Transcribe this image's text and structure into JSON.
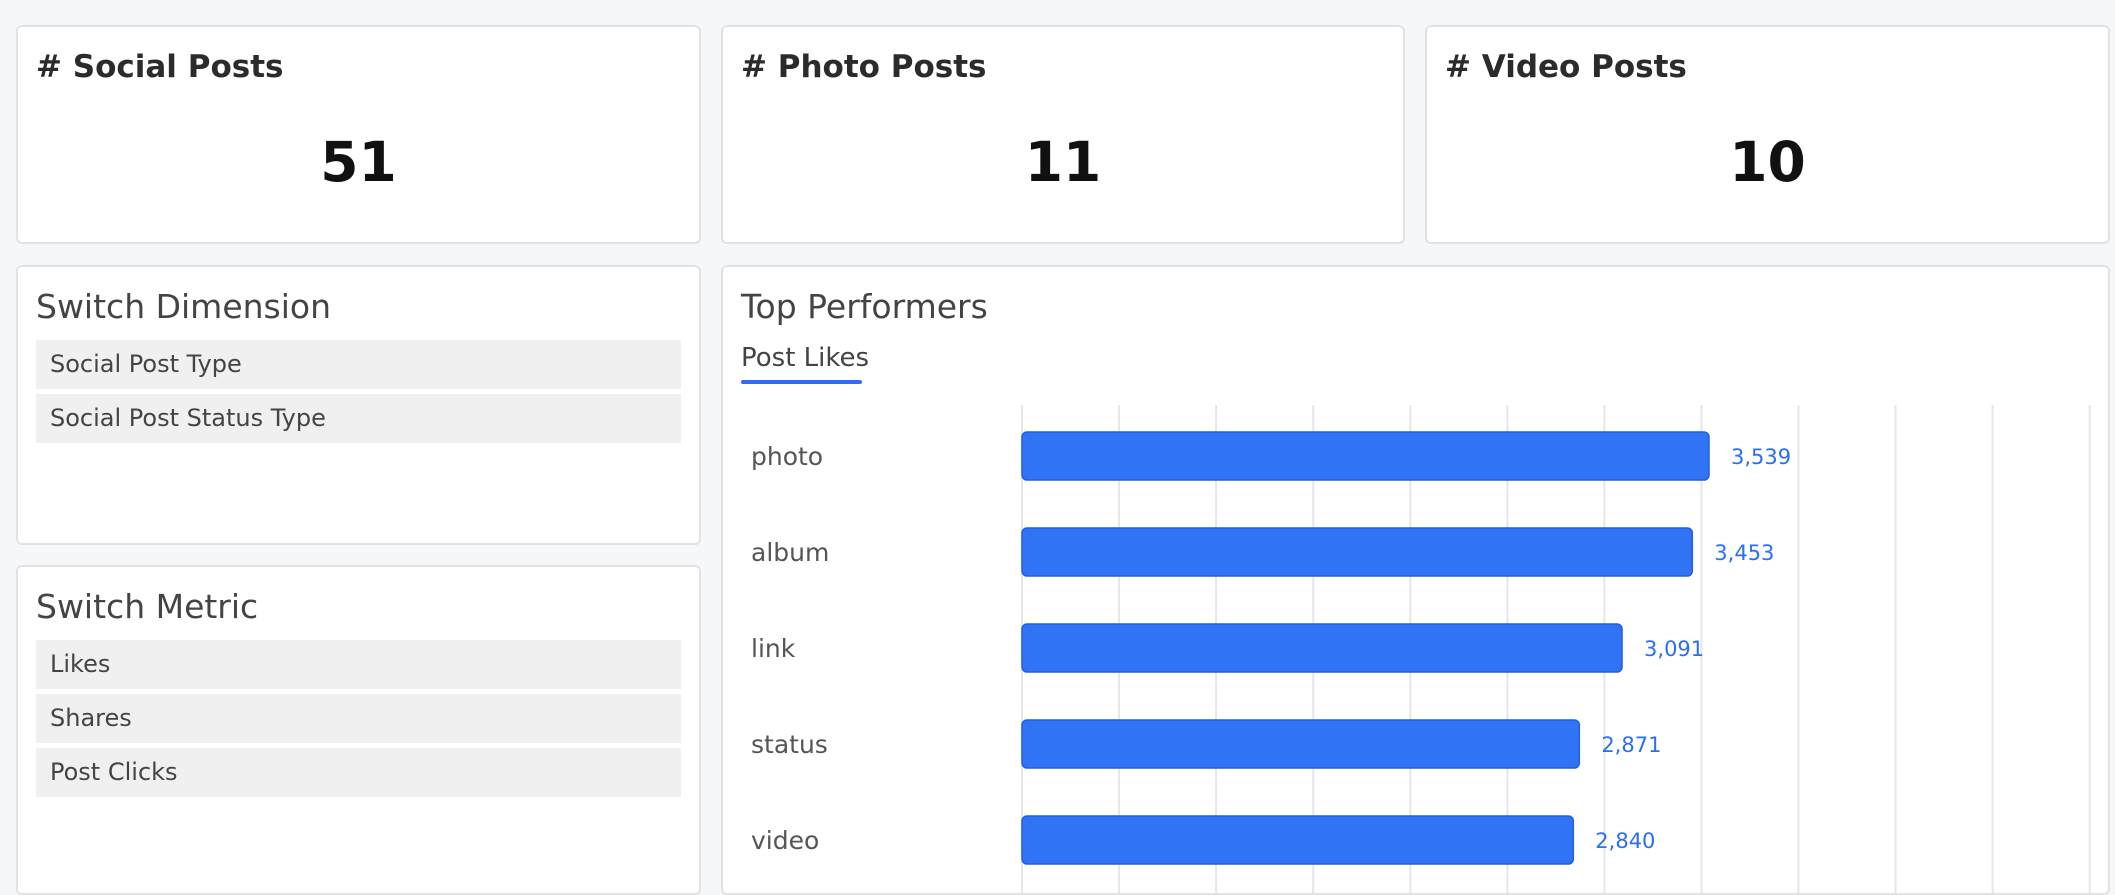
{
  "kpis": [
    {
      "title": "# Social Posts",
      "value": "51"
    },
    {
      "title": "# Photo Posts",
      "value": "11"
    },
    {
      "title": "# Video Posts",
      "value": "10"
    }
  ],
  "dimension_panel": {
    "title": "Switch Dimension",
    "options": [
      "Social Post Type",
      "Social Post Status Type"
    ]
  },
  "metric_panel": {
    "title": "Switch Metric",
    "options": [
      "Likes",
      "Shares",
      "Post Clicks"
    ]
  },
  "top_performers": {
    "title": "Top Performers",
    "active_tab": "Post Likes"
  },
  "colors": {
    "accent": "#2b6ef2",
    "bar": "#3074f5",
    "bar_border": "#1f5fe0",
    "value_label": "#2b6ef2",
    "gridline": "#e6e6e6"
  },
  "chart_data": {
    "type": "bar",
    "orientation": "horizontal",
    "categories": [
      "photo",
      "album",
      "link",
      "status",
      "video"
    ],
    "values": [
      3539,
      3453,
      3091,
      2871,
      2840
    ],
    "value_labels": [
      "3,539",
      "3,453",
      "3,091",
      "2,871",
      "2,840"
    ],
    "xlim": [
      0,
      5500
    ],
    "grid": true,
    "legend": "none"
  }
}
